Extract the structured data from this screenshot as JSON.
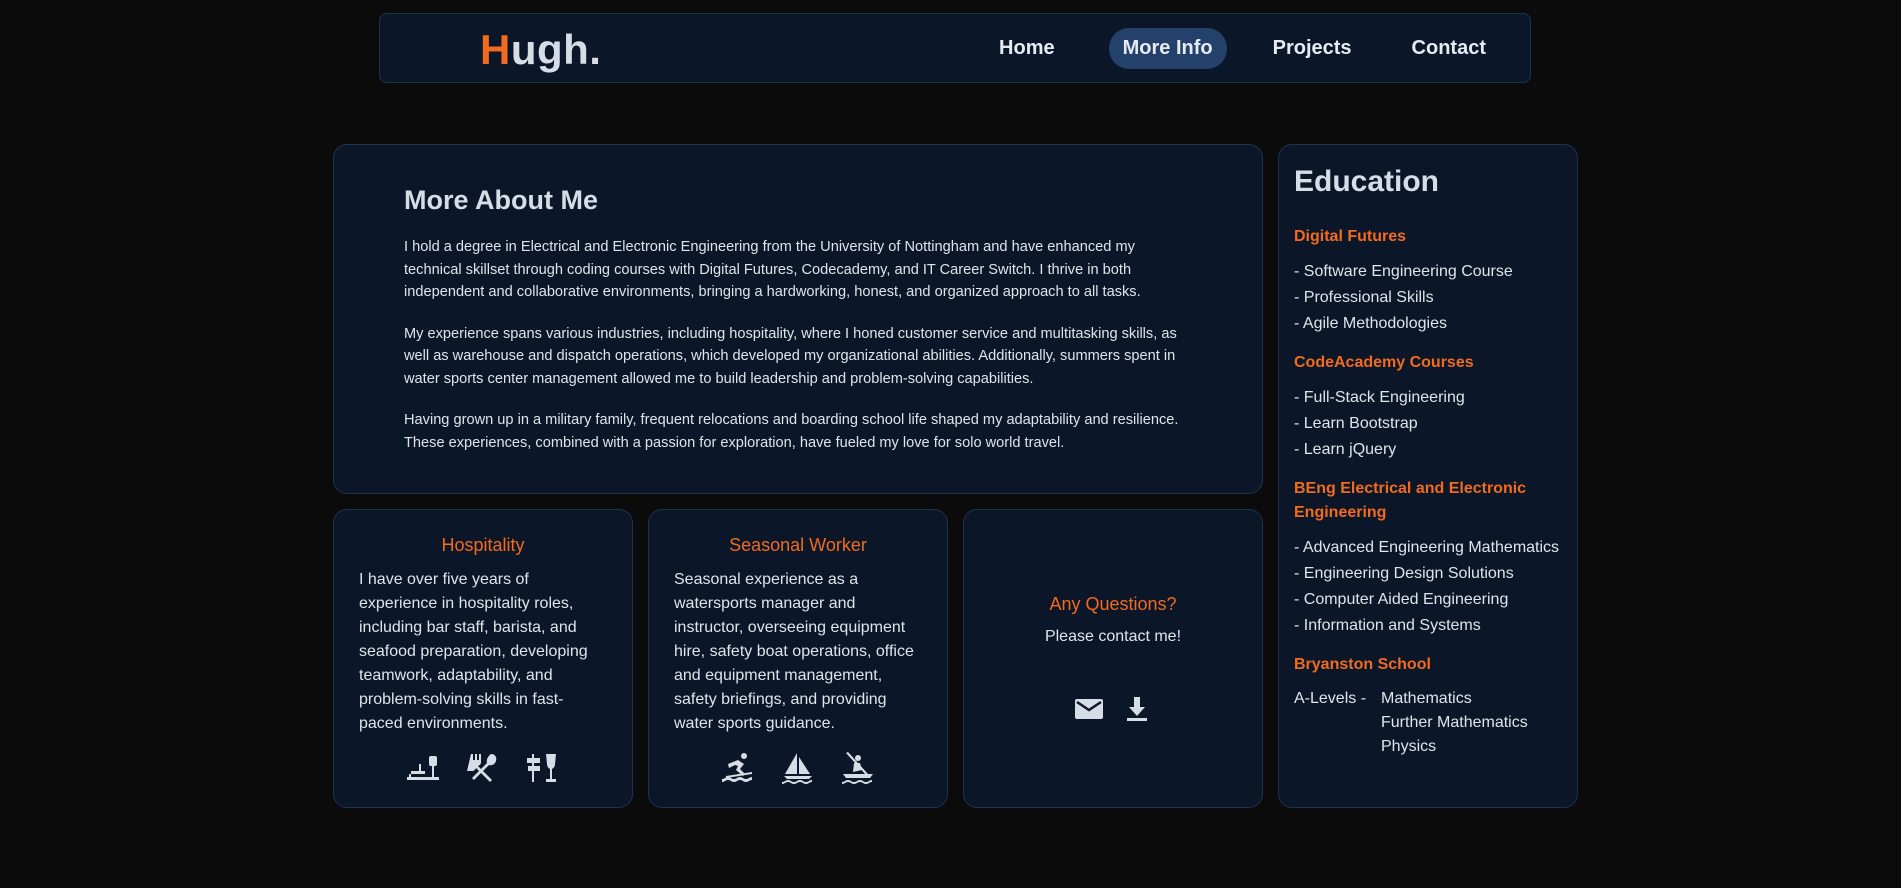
{
  "nav": {
    "logo_first": "H",
    "logo_rest": "ugh.",
    "links": [
      "Home",
      "More Info",
      "Projects",
      "Contact"
    ],
    "active": "More Info"
  },
  "about": {
    "title": "More About Me",
    "paragraphs": [
      "I hold a degree in Electrical and Electronic Engineering from the University of Nottingham and have enhanced my technical skillset through coding courses with Digital Futures, Codecademy, and IT Career Switch. I thrive in both independent and collaborative environments, bringing a hardworking, honest, and organized approach to all tasks.",
      "My experience spans various industries, including hospitality, where I honed customer service and multitasking skills, as well as warehouse and dispatch operations, which developed my organizational abilities. Additionally, summers spent in water sports center management allowed me to build leadership and problem-solving capabilities.",
      "Having grown up in a military family, frequent relocations and boarding school life shaped my adaptability and resilience. These experiences, combined with a passion for exploration, have fueled my love for solo world travel."
    ]
  },
  "cards": {
    "hospitality": {
      "title": "Hospitality",
      "text": "I have over five years of experience in hospitality roles, including bar staff, barista, and seafood preparation, developing teamwork, adaptability, and problem-solving skills in fast-paced environments.",
      "icons": [
        "bar-counter-icon",
        "fork-spoon-icon",
        "signpost-wine-icon"
      ]
    },
    "seasonal": {
      "title": "Seasonal Worker",
      "text": "Seasonal experience as a watersports manager and instructor, overseeing equipment hire, safety boat operations, office and equipment management, safety briefings, and providing water sports guidance.",
      "icons": [
        "surfing-icon",
        "sailing-icon",
        "kayaking-icon"
      ]
    },
    "contact": {
      "title": "Any Questions?",
      "text": "Please contact me!",
      "icons": [
        "mail-icon",
        "download-icon"
      ]
    }
  },
  "education": {
    "title": "Education",
    "sections": [
      {
        "name": "Digital Futures",
        "items": [
          "- Software Engineering Course",
          "- Professional Skills",
          "- Agile Methodologies"
        ]
      },
      {
        "name": "CodeAcademy Courses",
        "items": [
          "- Full-Stack Engineering",
          "- Learn Bootstrap",
          "- Learn jQuery"
        ]
      },
      {
        "name": "BEng Electrical and Electronic Engineering",
        "items": [
          "- Advanced Engineering Mathematics",
          "- Engineering Design Solutions",
          "- Computer Aided Engineering",
          "- Information and Systems"
        ]
      }
    ],
    "school": {
      "name": "Bryanston School",
      "label": "A-Levels -",
      "subjects": [
        "Mathematics",
        "Further Mathematics",
        "Physics"
      ]
    }
  },
  "colors": {
    "accent": "#f26a1b",
    "panel": "#0b1729",
    "background": "#0b0b0b",
    "active_nav": "#23416b"
  }
}
